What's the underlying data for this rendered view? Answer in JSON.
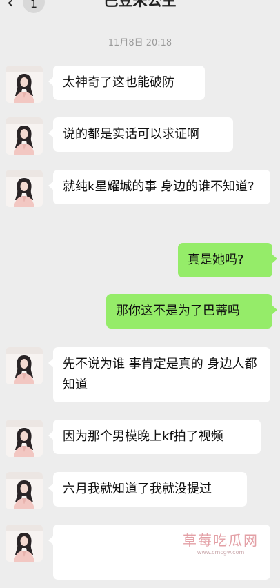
{
  "header": {
    "back_icon": "chevron-left-icon",
    "unread_count": "1",
    "title": "巴豆米公主"
  },
  "timestamp": "11月8日 20:18",
  "messages": [
    {
      "side": "left",
      "text": "太神奇了这也能破防"
    },
    {
      "side": "left",
      "text": "说的都是实话可以求证啊"
    },
    {
      "side": "left",
      "text": "就纯k星耀城的事 身边的谁不知道?"
    },
    {
      "side": "right",
      "text": "真是她吗?"
    },
    {
      "side": "right",
      "text": "那你这不是为了巴蒂吗"
    },
    {
      "side": "left",
      "text": "先不说为谁 事肯定是真的 身边人都知道"
    },
    {
      "side": "left",
      "text": "因为那个男模晚上kf拍了视频"
    },
    {
      "side": "left",
      "text": "六月我就知道了我就没提过"
    },
    {
      "side": "left",
      "text": ""
    }
  ],
  "watermark": {
    "title": "草莓吃瓜网",
    "url": "www.cmcgw.com"
  },
  "colors": {
    "background": "#ededed",
    "incoming_bubble": "#ffffff",
    "outgoing_bubble": "#95ec69"
  }
}
